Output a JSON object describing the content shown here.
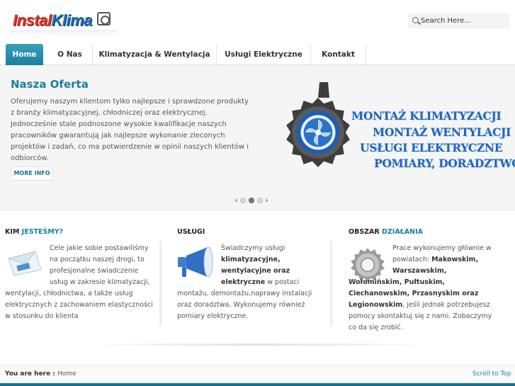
{
  "brand": {
    "logo_part1": "Instal",
    "logo_part2": "Klima"
  },
  "search": {
    "placeholder": "Search Here..."
  },
  "nav": {
    "items": [
      {
        "label": "Home",
        "active": true
      },
      {
        "label": "O Nas"
      },
      {
        "label": "Klimatyzacja & Wentylacja"
      },
      {
        "label": "Usługi Elektryczne"
      },
      {
        "label": "Kontakt"
      }
    ]
  },
  "slider": {
    "title": "Nasza Oferta",
    "text": "Oferujemy naszym klientom tylko najlepsze i sprawdzone produkty z branży klimatyzacyjnej, chłodniczej oraz elektrycznej. Jednocześnie stale podnoszone wysokie kwalifikacje naszych pracowników gwarantują jak najlepsze wykonanie zleconych projektów i zadań, co ma potwierdzenie w opinii naszych klientów i odbiorców.",
    "more_label": "MORE INFO",
    "active_slide": 2,
    "slide_count": 3,
    "banner_lines": [
      "MONTAŻ KLIMATYZACJI",
      "MONTAŻ WENTYLACJI",
      "USŁUGI ELEKTRYCZNE",
      "POMIARY, DORADZTWO"
    ]
  },
  "columns": [
    {
      "title_a": "KIM",
      "title_b": "JESTEŚMY?",
      "icon": "envelope-icon",
      "text_indented": [
        "Cele jakie sobie postawiliśmy",
        "na początku naszej drogi, to",
        "profesjonalne świadczenie",
        "usług w zakresie klimatyzacji,"
      ],
      "text_full": [
        "wentylacji, chłodnictwa, a także usług",
        "elektrycznych z zachowaniem elastyczności",
        "w stosunku do klienta"
      ]
    },
    {
      "title_a": "USŁUGI",
      "title_b": "",
      "icon": "megaphone-icon",
      "line1": "Świadczymy  usługi",
      "bold1": "klimatyzacyjne,",
      "bold2": "wentylacyjne oraz",
      "bold3": "elektryczne",
      "line2": " w postaci",
      "text_full": [
        "montażu, demontażu,naprawy instalacji",
        "oraz doradztwa. Wykonujemy również",
        "pomiary elektryczne."
      ]
    },
    {
      "title_a": "OBSZAR",
      "title_b": "DZIAŁANIA",
      "icon": "gear-icon",
      "line1": "Prace wykonujemy głównie w",
      "line2": "powiatach: ",
      "bold1": "Makowskim,",
      "bold2": "Warszawskim,",
      "bold3": "Wołomińskim, Pułtuskim,",
      "bold4": "Ciechanowskim, Przasnyskim oraz",
      "bold5": "Legionowskim",
      "line3": ", jeśli jednak potrzebujesz",
      "line4": "pomocy skontaktuj się z nami. Zobaczymy",
      "line5": "co da się zrobić."
    }
  ],
  "footer": {
    "you_are_here": "You are here :",
    "crumb": "Home",
    "scroll_top": "Scroll to Top"
  },
  "colors": {
    "accent": "#1a7f9c",
    "banner_text": "#1d66bd",
    "logo_red": "#d8342b",
    "logo_blue": "#1f6fb5"
  }
}
